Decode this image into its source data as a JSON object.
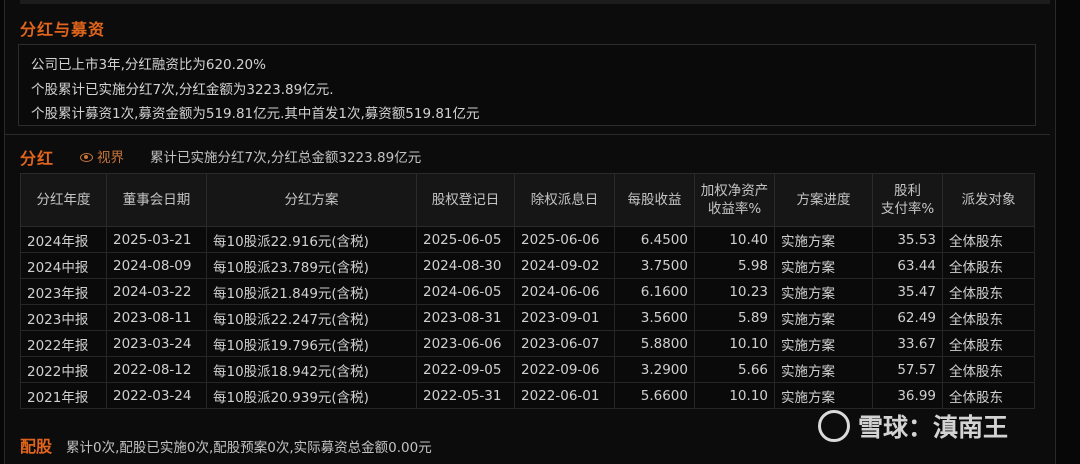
{
  "funding": {
    "title": "分红与募资",
    "lines": [
      "公司已上市3年,分红融资比为620.20%",
      "个股累计已实施分红7次,分红金额为3223.89亿元.",
      "个股累计募资1次,募资金额为519.81亿元.其中首发1次,募资额519.81亿元"
    ]
  },
  "dividend": {
    "title": "分红",
    "view_link": "视界",
    "summary": "累计已实施分红7次,分红总金额3223.89亿元",
    "headers": [
      "分红年度",
      "董事会日期",
      "分红方案",
      "股权登记日",
      "除权派息日",
      "每股收益",
      "加权净资产收益率%",
      "方案进度",
      "股利支付率%",
      "派发对象"
    ],
    "header_lines": {
      "roe_line1": "加权净资产",
      "roe_line2": "收益率%",
      "payout_line1": "股利",
      "payout_line2": "支付率%"
    },
    "rows": [
      {
        "year": "2024年报",
        "board": "2025-03-21",
        "plan": "每10股派22.916元(含税)",
        "reg": "2025-06-05",
        "ex": "2025-06-06",
        "eps": "6.4500",
        "roe": "10.40",
        "progress": "实施方案",
        "payout": "35.53",
        "target": "全体股东"
      },
      {
        "year": "2024中报",
        "board": "2024-08-09",
        "plan": "每10股派23.789元(含税)",
        "reg": "2024-08-30",
        "ex": "2024-09-02",
        "eps": "3.7500",
        "roe": "5.98",
        "progress": "实施方案",
        "payout": "63.44",
        "target": "全体股东"
      },
      {
        "year": "2023年报",
        "board": "2024-03-22",
        "plan": "每10股派21.849元(含税)",
        "reg": "2024-06-05",
        "ex": "2024-06-06",
        "eps": "6.1600",
        "roe": "10.23",
        "progress": "实施方案",
        "payout": "35.47",
        "target": "全体股东"
      },
      {
        "year": "2023中报",
        "board": "2023-08-11",
        "plan": "每10股派22.247元(含税)",
        "reg": "2023-08-31",
        "ex": "2023-09-01",
        "eps": "3.5600",
        "roe": "5.89",
        "progress": "实施方案",
        "payout": "62.49",
        "target": "全体股东"
      },
      {
        "year": "2022年报",
        "board": "2023-03-24",
        "plan": "每10股派19.796元(含税)",
        "reg": "2023-06-06",
        "ex": "2023-06-07",
        "eps": "5.8800",
        "roe": "10.10",
        "progress": "实施方案",
        "payout": "33.67",
        "target": "全体股东"
      },
      {
        "year": "2022中报",
        "board": "2022-08-12",
        "plan": "每10股派18.942元(含税)",
        "reg": "2022-09-05",
        "ex": "2022-09-06",
        "eps": "3.2900",
        "roe": "5.66",
        "progress": "实施方案",
        "payout": "57.57",
        "target": "全体股东"
      },
      {
        "year": "2021年报",
        "board": "2022-03-24",
        "plan": "每10股派20.939元(含税)",
        "reg": "2022-05-31",
        "ex": "2022-06-01",
        "eps": "5.6600",
        "roe": "10.10",
        "progress": "实施方案",
        "payout": "36.99",
        "target": "全体股东"
      }
    ]
  },
  "rights_issue": {
    "title": "配股",
    "text": "累计0次,配股已实施0次,配股预案0次,实际募资总金额0.00元"
  },
  "watermark": {
    "text": "雪球：滇南王"
  },
  "colors": {
    "accent": "#e0641b",
    "link": "#c8763a",
    "background": "#0c0c0c"
  }
}
